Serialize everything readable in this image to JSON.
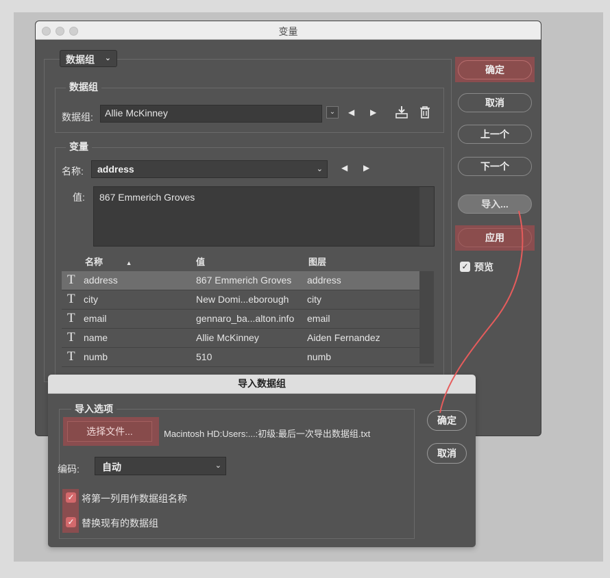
{
  "main_window": {
    "title": "变量",
    "dataset_mode": "数据组",
    "dataset_group": {
      "legend": "数据组",
      "label": "数据组:",
      "value": "Allie McKinney"
    },
    "variable_group": {
      "legend": "变量",
      "name_label": "名称:",
      "name_value": "address",
      "value_label": "值:",
      "value_text": "867 Emmerich Groves"
    },
    "table": {
      "headers": [
        "名称",
        "值",
        "图层"
      ],
      "sort_indicator": "▲",
      "rows": [
        {
          "icon": "T",
          "name": "address",
          "value": "867 Emmerich Groves",
          "layer": "address"
        },
        {
          "icon": "T",
          "name": "city",
          "value": "New Domi...eborough",
          "layer": "city"
        },
        {
          "icon": "T",
          "name": "email",
          "value": "gennaro_ba...alton.info",
          "layer": "email"
        },
        {
          "icon": "T",
          "name": "name",
          "value": "Allie McKinney",
          "layer": "Aiden Fernandez"
        },
        {
          "icon": "T",
          "name": "numb",
          "value": "510",
          "layer": "numb"
        }
      ]
    },
    "buttons": {
      "ok": "确定",
      "cancel": "取消",
      "prev": "上一个",
      "next": "下一个",
      "import": "导入...",
      "apply": "应用"
    },
    "preview_label": "预览",
    "preview_checked": true
  },
  "import_dialog": {
    "title": "导入数据组",
    "options_legend": "导入选项",
    "choose_file": "选择文件...",
    "file_path": "Macintosh HD:Users:...:初级:最后一次导出数据组.txt",
    "encoding_label": "编码:",
    "encoding_value": "自动",
    "checkbox_first_col": "将第一列用作数据组名称",
    "checkbox_replace": "替换现有的数据组",
    "ok": "确定",
    "cancel": "取消"
  },
  "colors": {
    "accent_red": "#8b4d4d",
    "checkbox_red": "#d4696c",
    "annotation_arrow": "#e65c5c",
    "panel": "#535353"
  }
}
